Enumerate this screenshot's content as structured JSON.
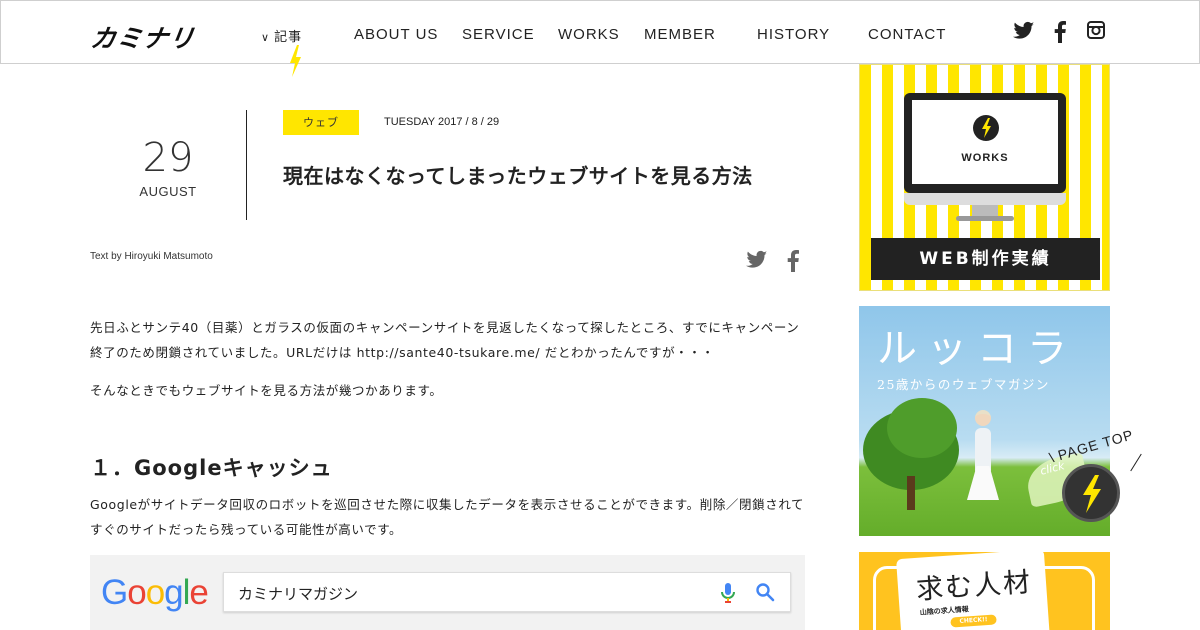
{
  "site": {
    "logo": "カミナリ"
  },
  "nav": {
    "articles_label": "記事",
    "items": [
      "ABOUT US",
      "SERVICE",
      "WORKS",
      "MEMBER",
      "HISTORY",
      "CONTACT"
    ]
  },
  "social": {
    "icons": [
      "twitter-icon",
      "facebook-icon",
      "instagram-icon"
    ]
  },
  "article": {
    "day": "29",
    "month": "AUGUST",
    "category": "ウェブ",
    "date": "TUESDAY 2017 / 8 / 29",
    "title": "現在はなくなってしまったウェブサイトを見る方法",
    "author": "Text by Hiroyuki Matsumoto",
    "paragraph1": "先日ふとサンテ40（目薬）とガラスの仮面のキャンペーンサイトを見返したくなって探したところ、すでにキャンペーン終了のため閉鎖されていました。URLだけは http://sante40-tsukare.me/ だとわかったんですが・・・",
    "paragraph2": "そんなときでもウェブサイトを見る方法が幾つかあります。",
    "heading1": "１．Googleキャッシュ",
    "paragraph3": "Googleがサイトデータ回収のロボットを巡回させた際に収集したデータを表示させることができます。削除／閉鎖されてすぐのサイトだったら残っている可能性が高いです。"
  },
  "google_screenshot": {
    "logo_letters": [
      "G",
      "o",
      "o",
      "g",
      "l",
      "e"
    ],
    "logo_colors": [
      "#4285f4",
      "#ea4335",
      "#fbbc05",
      "#4285f4",
      "#34a853",
      "#ea4335"
    ],
    "query": "カミナリマガジン"
  },
  "sidebar": {
    "works_label": "WORKS",
    "works_banner": "WEB制作実績",
    "ruccola_title": "ルッコラ",
    "ruccola_subtitle": "25歳からのウェブマガジン",
    "hiring_title": "求む人材",
    "hiring_sub": "山陰の求人情報",
    "hiring_check": "CHECK!!"
  },
  "page_top": {
    "label": "PAGE TOP",
    "click": "click"
  },
  "colors": {
    "accent_yellow": "#ffe600",
    "text": "#222222"
  }
}
